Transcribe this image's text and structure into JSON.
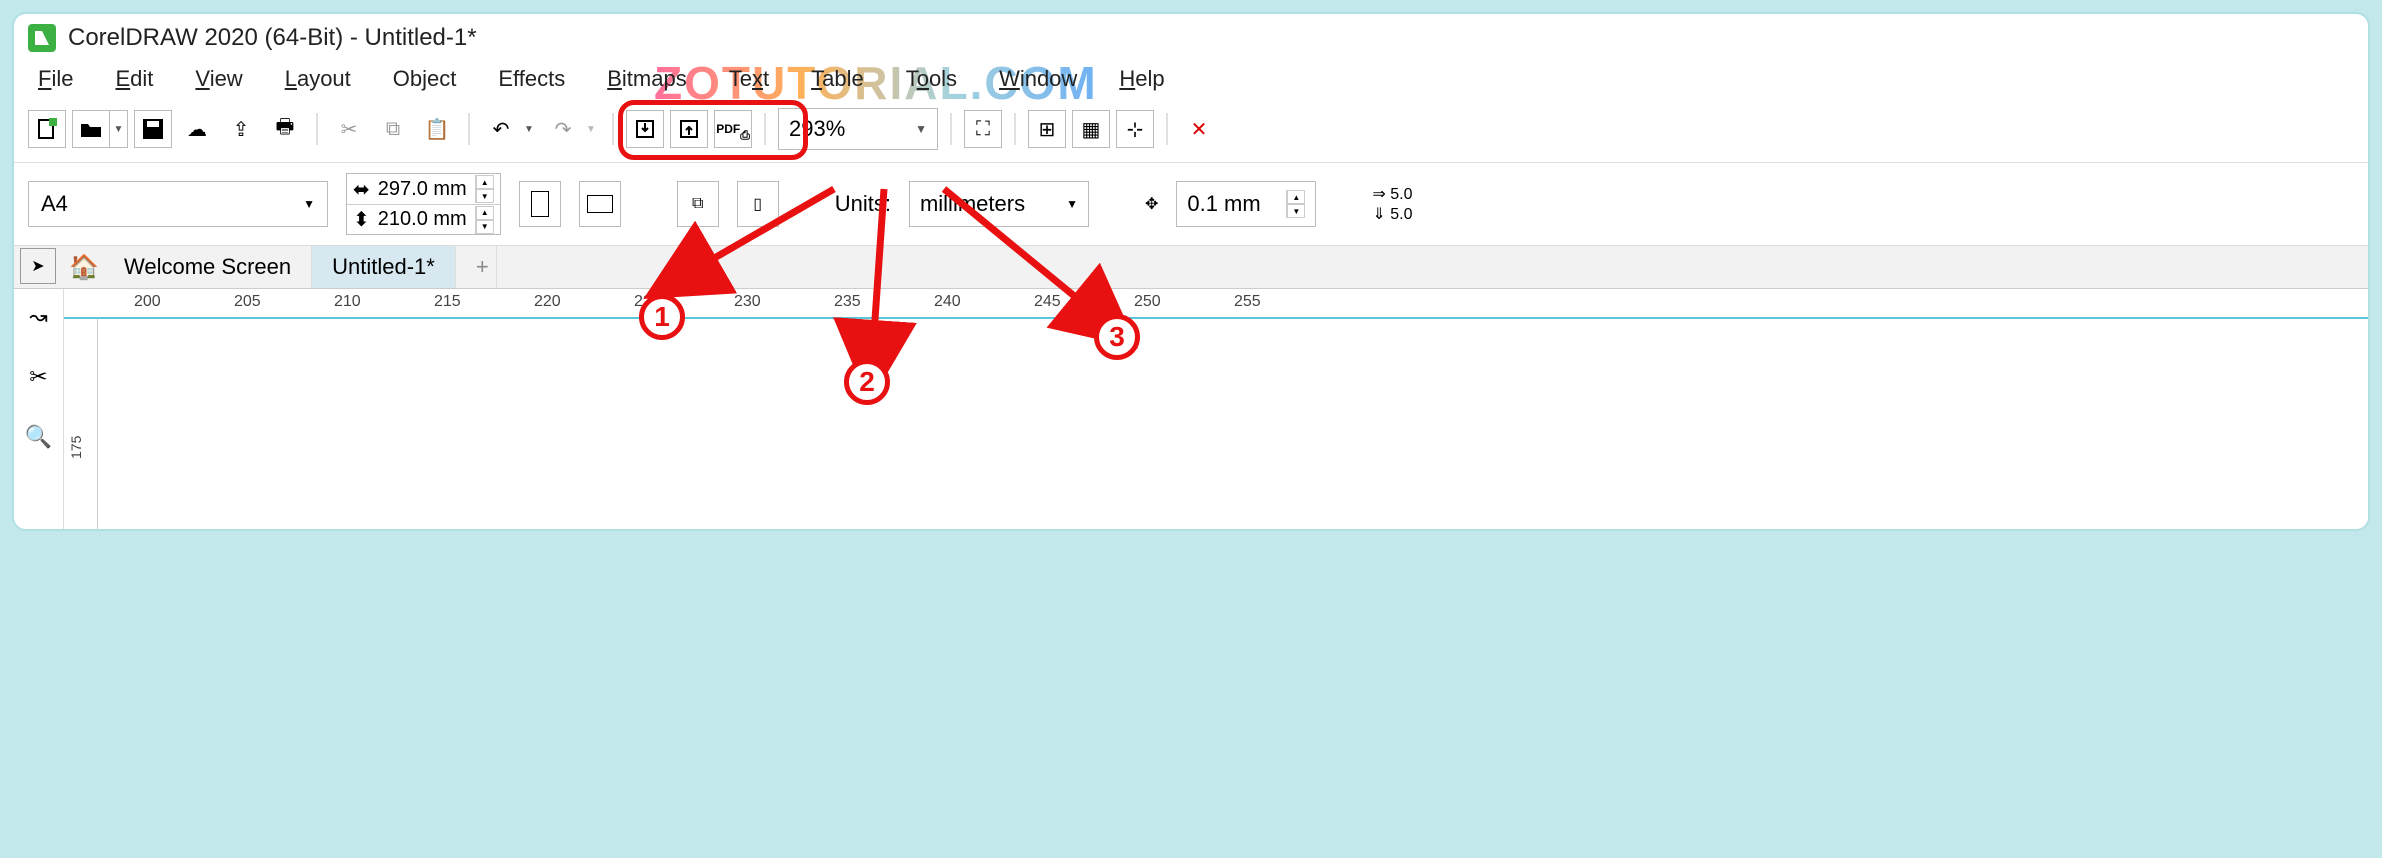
{
  "title": "CorelDRAW 2020 (64-Bit) - Untitled-1*",
  "watermark": "ZOTUTORIAL.COM",
  "menu": {
    "file": "File",
    "edit": "Edit",
    "view": "View",
    "layout": "Layout",
    "object": "Object",
    "effects": "Effects",
    "bitmaps": "Bitmaps",
    "text": "Text",
    "table": "Table",
    "tools": "Tools",
    "window": "Window",
    "help": "Help"
  },
  "toolbar": {
    "zoom": "293%",
    "pdf": "PDF"
  },
  "propbar": {
    "pagesize": "A4",
    "width": "297.0 mm",
    "height": "210.0 mm",
    "units_label": "Units:",
    "units_value": "millimeters",
    "nudge": "0.1 mm",
    "dup_x": "5.0",
    "dup_y": "5.0"
  },
  "tabs": {
    "welcome": "Welcome Screen",
    "untitled": "Untitled-1*",
    "add": "+"
  },
  "ruler": {
    "ticks": [
      "200",
      "205",
      "210",
      "215",
      "220",
      "225",
      "230",
      "235",
      "240",
      "245",
      "250",
      "255"
    ]
  },
  "vruler": {
    "tick": "175"
  },
  "annotations": {
    "one": "1",
    "two": "2",
    "three": "3"
  }
}
